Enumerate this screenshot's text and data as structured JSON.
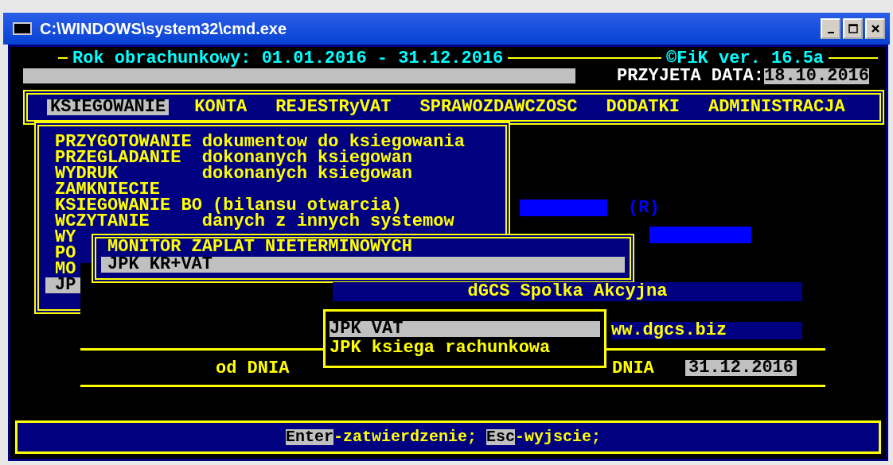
{
  "window": {
    "title": "C:\\WINDOWS\\system32\\cmd.exe"
  },
  "header": {
    "period": "Rok obrachunkowy: 01.01.2016 - 31.12.2016",
    "version": "©FiK ver. 16.5a",
    "date_label": "PRZYJETA DATA:",
    "date_value": "18.10.2016"
  },
  "menu_bar": [
    {
      "label": "KSIEGOWANIE",
      "selected": true
    },
    {
      "label": "KONTA",
      "selected": false
    },
    {
      "label": "REJESTRyVAT",
      "selected": false
    },
    {
      "label": "SPRAWOZDAWCZOSC",
      "selected": false
    },
    {
      "label": "DODATKI",
      "selected": false
    },
    {
      "label": "ADMINISTRACJA",
      "selected": false
    }
  ],
  "submenu": [
    {
      "label": "PRZYGOTOWANIE",
      "description": "dokumentow do ksiegowania",
      "selected": false
    },
    {
      "label": "PRZEGLADANIE",
      "description": "dokonanych ksiegowan",
      "selected": false
    },
    {
      "label": "WYDRUK",
      "description": "dokonanych ksiegowan",
      "selected": false
    },
    {
      "label": "ZAMKNIECIE",
      "selected": false
    },
    {
      "label": "KSIEGOWANIE BO (bilansu otwarcia)",
      "selected": false
    },
    {
      "label": "WCZYTANIE",
      "description": "danych z innych systemow",
      "selected": false
    },
    {
      "label": "WY",
      "selected": false
    },
    {
      "label": "PO",
      "selected": false
    },
    {
      "label": "MO",
      "selected": false
    },
    {
      "label": "JP",
      "selected": true
    }
  ],
  "background": {
    "registered_mark": "(R)",
    "company": "dGCS Spolka Akcyjna",
    "website": "ww.dgcs.biz",
    "from_label": "od DNIA",
    "to_label": "DNIA",
    "to_value": "31.12.2016"
  },
  "jpk_menu": [
    {
      "label": "MONITOR ZAPLAT NIETERMINOWYCH",
      "selected": false
    },
    {
      "label": "JPK KR+VAT",
      "selected": true
    }
  ],
  "jpk_type_menu": [
    {
      "label": "JPK VAT",
      "selected": true
    },
    {
      "label": "JPK ksiega rachunkowa",
      "selected": false
    }
  ],
  "status_bar": [
    {
      "key": "Enter",
      "text": "-zatwierdzenie;"
    },
    {
      "key": "Esc",
      "text": "-wyjscie;"
    }
  ]
}
